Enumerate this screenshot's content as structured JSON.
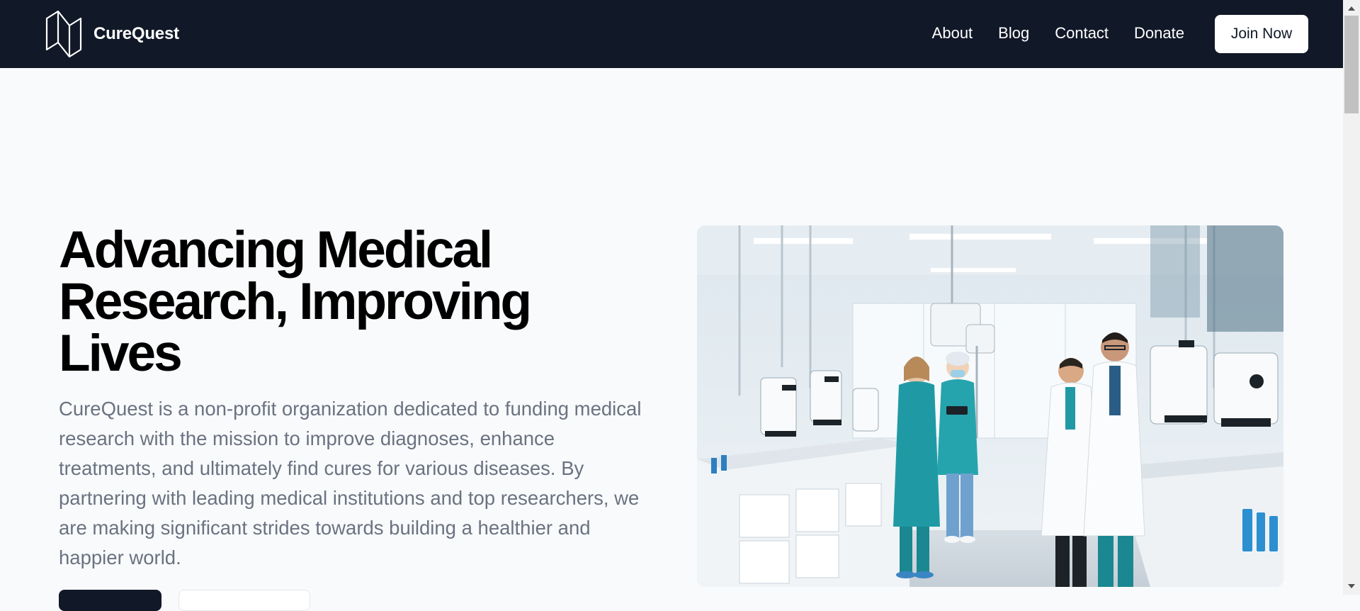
{
  "brand": {
    "name": "CureQuest",
    "logo_icon": "cube-outline-icon"
  },
  "nav": {
    "links": [
      "About",
      "Blog",
      "Contact",
      "Donate"
    ],
    "cta_label": "Join Now"
  },
  "hero": {
    "title": "Advancing Medical Research, Improving Lives",
    "description": "CureQuest is a non-profit organization dedicated to funding medical research with the mission to improve diagnoses, enhance treatments, and ultimately find cures for various diseases. By partnering with leading medical institutions and top researchers, we are making significant strides towards building a healthier and happier world.",
    "image_subject": "lab-researchers-photo"
  },
  "colors": {
    "nav_bg": "#111827",
    "page_bg": "#f8fafc",
    "title": "#000000",
    "body_text": "#6b7280",
    "scrub_teal": "#1f9aa5"
  }
}
